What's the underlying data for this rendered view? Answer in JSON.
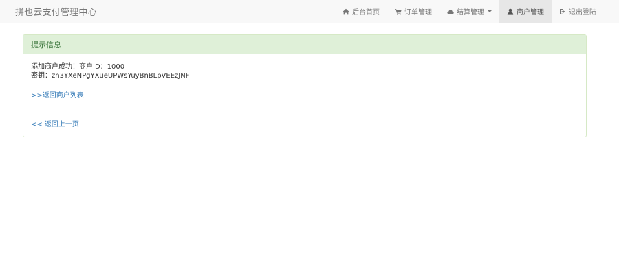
{
  "brand": "拼也云支付管理中心",
  "nav": {
    "items": [
      {
        "label": "后台首页",
        "icon": "home-icon"
      },
      {
        "label": "订单管理",
        "icon": "cart-icon"
      },
      {
        "label": "结算管理",
        "icon": "cloud-icon"
      },
      {
        "label": "商户管理",
        "icon": "user-icon"
      },
      {
        "label": "退出登陆",
        "icon": "logout-icon"
      }
    ]
  },
  "panel": {
    "title": "提示信息",
    "success_message": "添加商户成功！商户ID：1000",
    "secret_line": "密钥：zn3YXeNPgYXueUPWsYuyBnBLpVEEzJNF",
    "return_list_link": ">>返回商户列表",
    "back_link": "<< 返回上一页"
  },
  "colors": {
    "navbar_bg": "#f8f8f8",
    "active_nav_bg": "#e7e7e7",
    "panel_heading_bg": "#dff0d8",
    "panel_heading_text": "#3c763d",
    "link": "#337ab7"
  }
}
